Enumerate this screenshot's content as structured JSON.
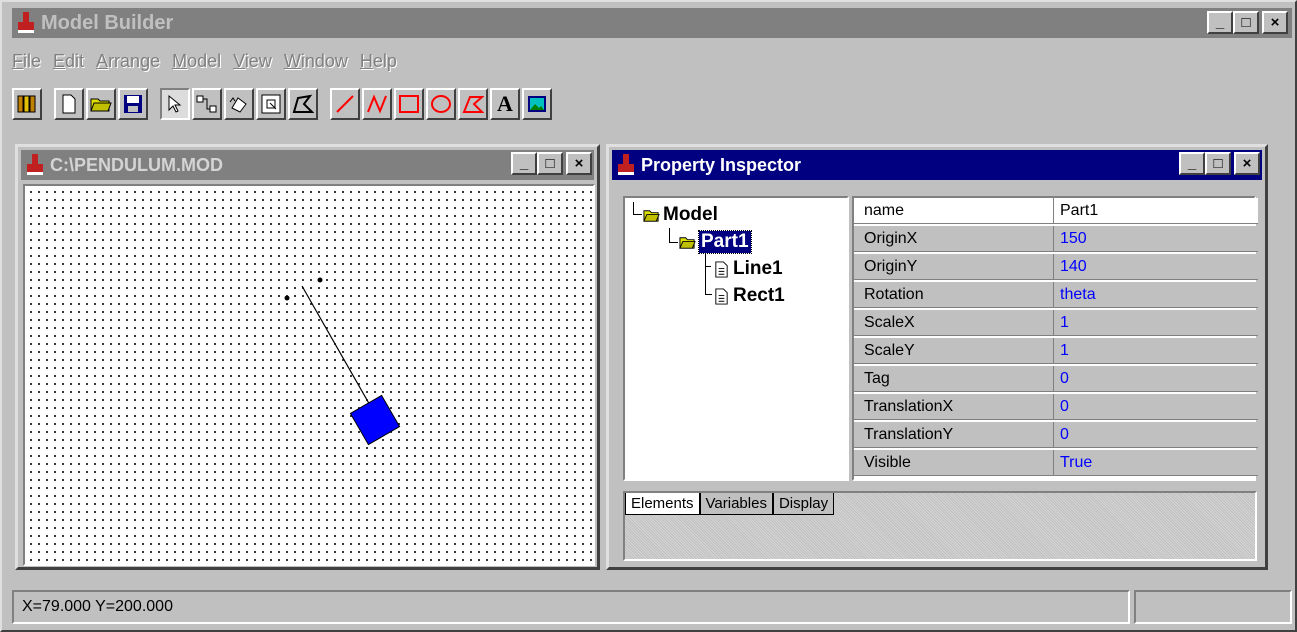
{
  "app": {
    "title": "Model Builder"
  },
  "menu": [
    "File",
    "Edit",
    "Arrange",
    "Model",
    "View",
    "Window",
    "Help"
  ],
  "toolbar": {
    "icons": [
      "library-icon",
      "new-file-icon",
      "open-folder-icon",
      "save-icon",
      "pointer-icon",
      "connect-icon",
      "rotate-icon",
      "resize-icon",
      "polygon-edit-icon",
      "line-tool-icon",
      "polyline-tool-icon",
      "rectangle-tool-icon",
      "ellipse-tool-icon",
      "polygon-tool-icon",
      "text-tool-icon",
      "image-tool-icon"
    ],
    "text_tool_label": "A"
  },
  "document": {
    "title": "C:\\PENDULUM.MOD"
  },
  "inspector": {
    "title": "Property Inspector",
    "tree": {
      "root": "Model",
      "part": "Part1",
      "children": [
        "Line1",
        "Rect1"
      ]
    },
    "properties": [
      {
        "name": "name",
        "value": "Part1"
      },
      {
        "name": "OriginX",
        "value": "150"
      },
      {
        "name": "OriginY",
        "value": "140"
      },
      {
        "name": "Rotation",
        "value": "theta"
      },
      {
        "name": "ScaleX",
        "value": "1"
      },
      {
        "name": "ScaleY",
        "value": "1"
      },
      {
        "name": "Tag",
        "value": "0"
      },
      {
        "name": "TranslationX",
        "value": "0"
      },
      {
        "name": "TranslationY",
        "value": "0"
      },
      {
        "name": "Visible",
        "value": "True"
      }
    ],
    "tabs": [
      "Elements",
      "Variables",
      "Display"
    ]
  },
  "window_buttons": {
    "minimize": "_",
    "maximize": "□",
    "close": "×"
  },
  "status": {
    "coords": "X=79.000  Y=200.000"
  },
  "colors": {
    "active_title": "#000080",
    "inactive_title": "#808080",
    "pendulum_bob": "#0000ff",
    "value_text": "#0000ff"
  }
}
